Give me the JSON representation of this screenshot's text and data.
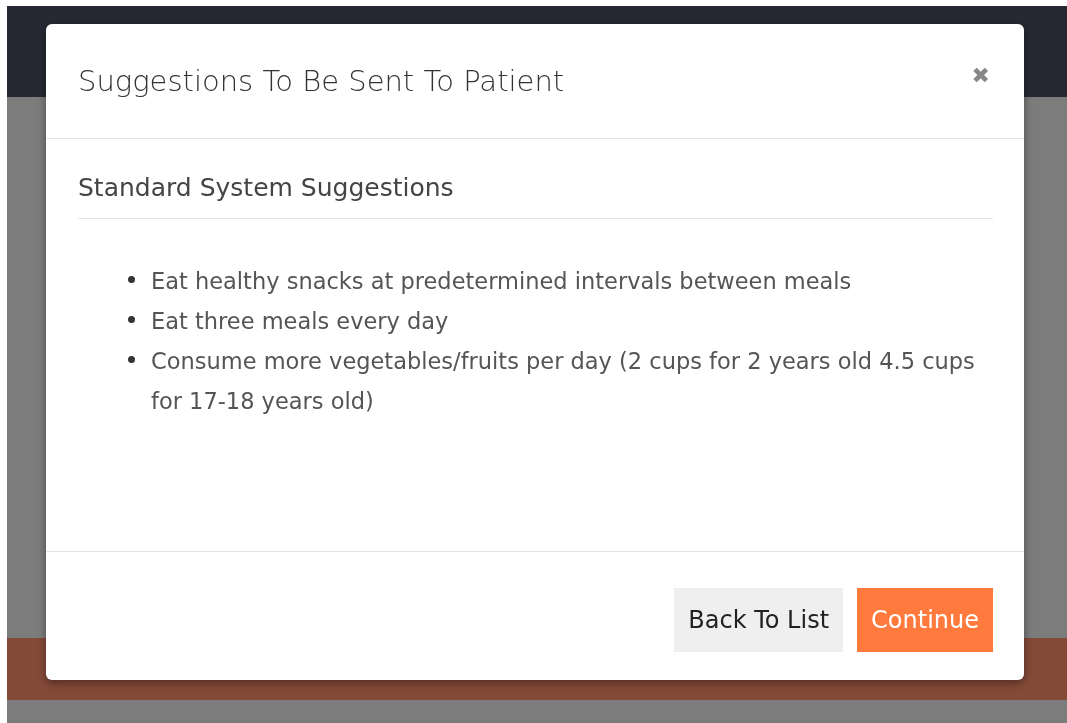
{
  "modal": {
    "title": "Suggestions To Be Sent To Patient",
    "close": "✖",
    "section_title": "Standard System Suggestions",
    "suggestions": [
      "Eat healthy snacks at predetermined intervals between meals",
      "Eat three meals every day",
      "Consume more vegetables/fruits per day (2 cups for 2 years old 4.5 cups for 17-18 years old)"
    ],
    "buttons": [
      {
        "label": "Back To List",
        "kind": "secondary"
      },
      {
        "label": "Continue",
        "kind": "primary"
      }
    ]
  }
}
